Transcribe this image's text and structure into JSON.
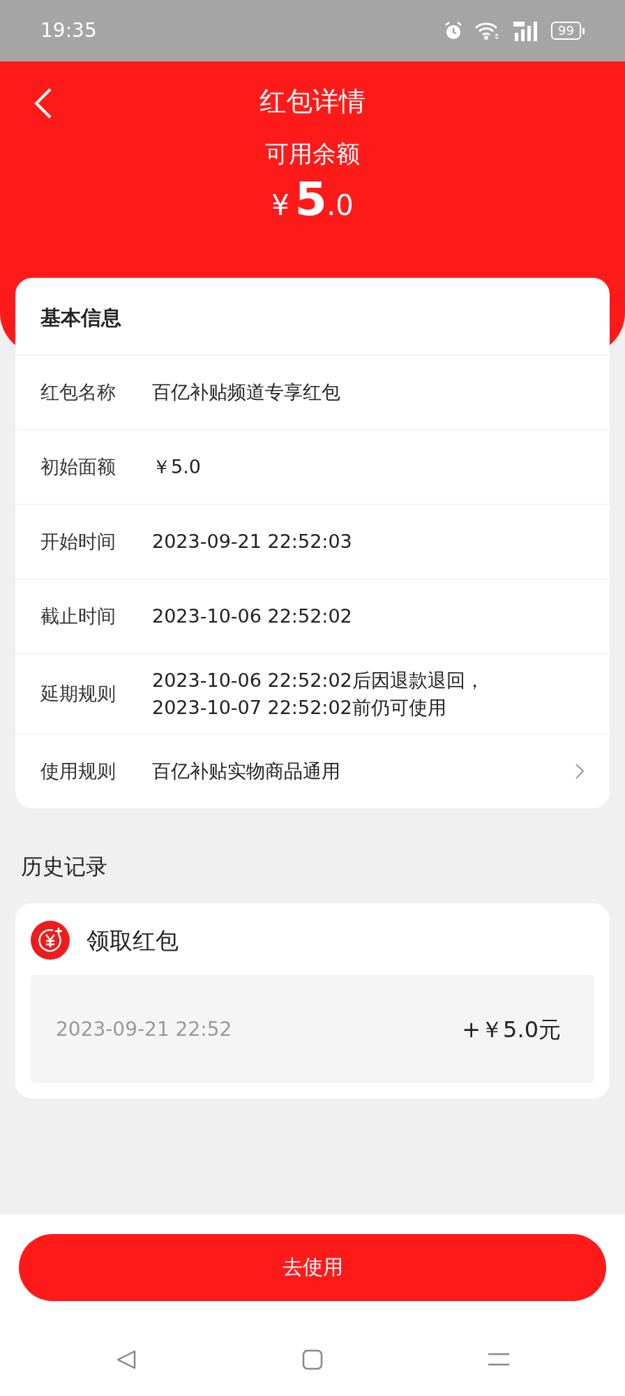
{
  "status_bar": {
    "time": "19:35",
    "battery": "99"
  },
  "header": {
    "title": "红包详情"
  },
  "balance": {
    "label": "可用余额",
    "currency": "¥",
    "integer": "5",
    "decimal": ".0"
  },
  "info": {
    "title": "基本信息",
    "rows": [
      {
        "kind": "text",
        "label": "红包名称",
        "lines": [
          "百亿补贴频道专享红包"
        ]
      },
      {
        "kind": "text",
        "label": "初始面额",
        "lines": [
          "￥5.0"
        ]
      },
      {
        "kind": "text",
        "label": "开始时间",
        "lines": [
          "2023-09-21 22:52:03"
        ]
      },
      {
        "kind": "text",
        "label": "截止时间",
        "lines": [
          "2023-10-06 22:52:02"
        ]
      },
      {
        "kind": "text",
        "label": "延期规则",
        "lines": [
          "2023-10-06 22:52:02后因退款退回，",
          "2023-10-07 22:52:02前仍可使用"
        ]
      },
      {
        "kind": "link",
        "label": "使用规则",
        "lines": [
          "百亿补贴实物商品通用"
        ]
      }
    ]
  },
  "history": {
    "title": "历史记录",
    "records": [
      {
        "title": "领取红包",
        "date": "2023-09-21 22:52",
        "amount": "+￥5.0元"
      }
    ]
  },
  "action": {
    "label": "去使用"
  }
}
